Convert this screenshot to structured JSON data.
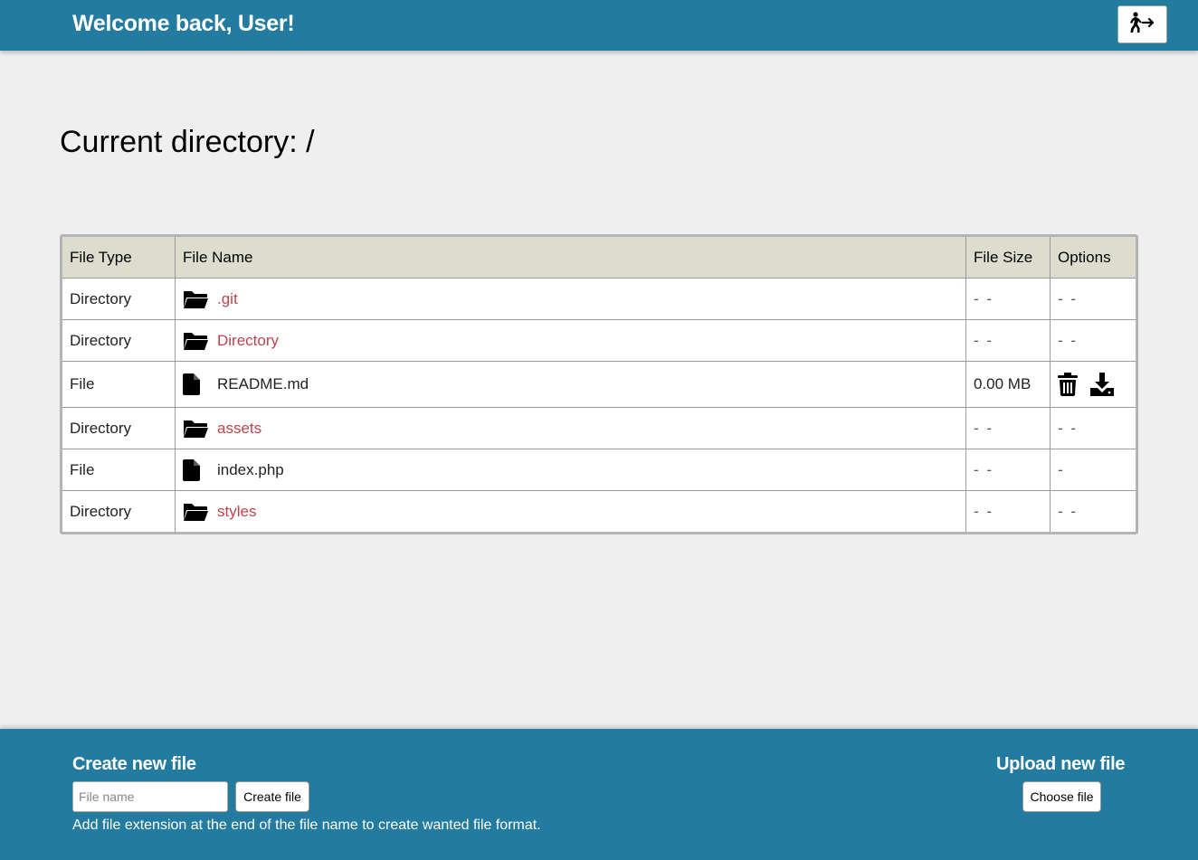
{
  "header": {
    "welcome": "Welcome back, User!",
    "logout_icon": "person-exit-icon"
  },
  "main": {
    "current_directory": "Current directory: /"
  },
  "table": {
    "headers": [
      "File Type",
      "File Name",
      "File Size",
      "Options"
    ],
    "rows": [
      {
        "type": "Directory",
        "name": ".git",
        "size": "- -",
        "options": "- -",
        "icon": "folder-open-icon"
      },
      {
        "type": "Directory",
        "name": "Directory",
        "size": "- -",
        "options": "- -",
        "icon": "folder-open-icon"
      },
      {
        "type": "File",
        "name": "README.md",
        "size": "0.00 MB",
        "options": "",
        "icon": "file-icon",
        "actions": [
          "trash-icon",
          "download-icon"
        ]
      },
      {
        "type": "Directory",
        "name": "assets",
        "size": "- -",
        "options": "- -",
        "icon": "folder-open-icon"
      },
      {
        "type": "File",
        "name": "index.php",
        "size": "- -",
        "options": "-",
        "icon": "file-icon"
      },
      {
        "type": "Directory",
        "name": "styles",
        "size": "- -",
        "options": "- -",
        "icon": "folder-open-icon"
      }
    ]
  },
  "footer": {
    "create_title": "Create new file",
    "create_placeholder": "File name",
    "create_button": "Create file",
    "hint": "Add file extension at the end of the file name to create wanted file format.",
    "upload_title": "Upload new file",
    "choose_button": "Choose file"
  },
  "colors": {
    "brand": "#247ba0",
    "link": "#c0444a",
    "header_row": "#ddddcf",
    "background": "#efefef"
  }
}
